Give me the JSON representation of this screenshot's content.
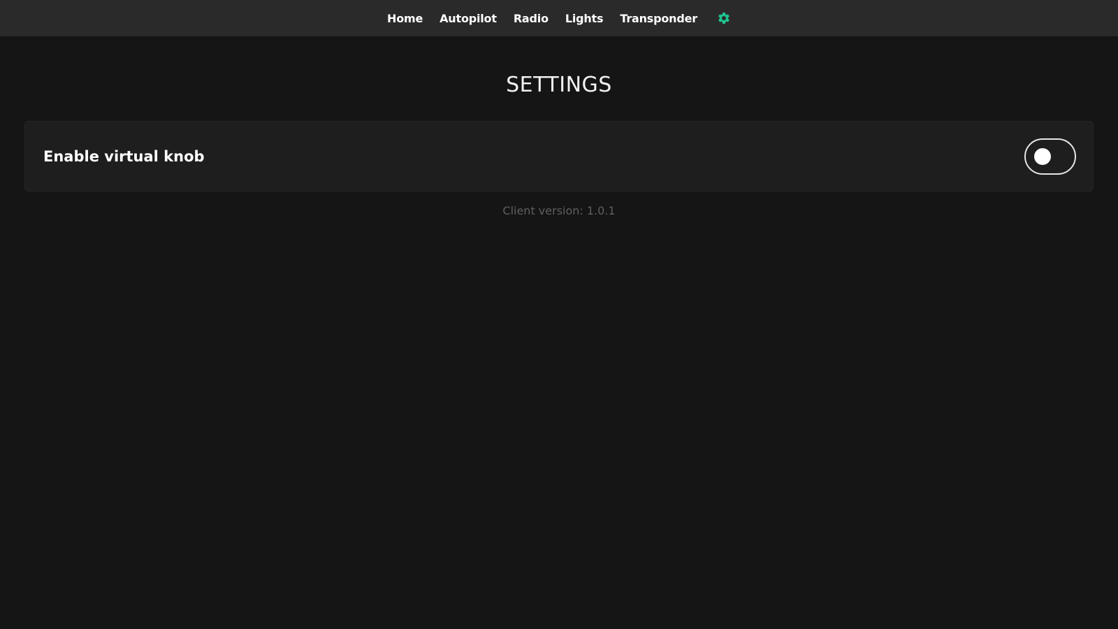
{
  "nav": {
    "items": [
      {
        "label": "Home"
      },
      {
        "label": "Autopilot"
      },
      {
        "label": "Radio"
      },
      {
        "label": "Lights"
      },
      {
        "label": "Transponder"
      }
    ],
    "settings_icon": "gear-icon",
    "accent_color": "#1fc28f"
  },
  "page": {
    "title": "SETTINGS"
  },
  "settings": {
    "virtual_knob": {
      "label": "Enable virtual knob",
      "enabled": false
    }
  },
  "footer": {
    "version_text": "Client version: 1.0.1"
  }
}
